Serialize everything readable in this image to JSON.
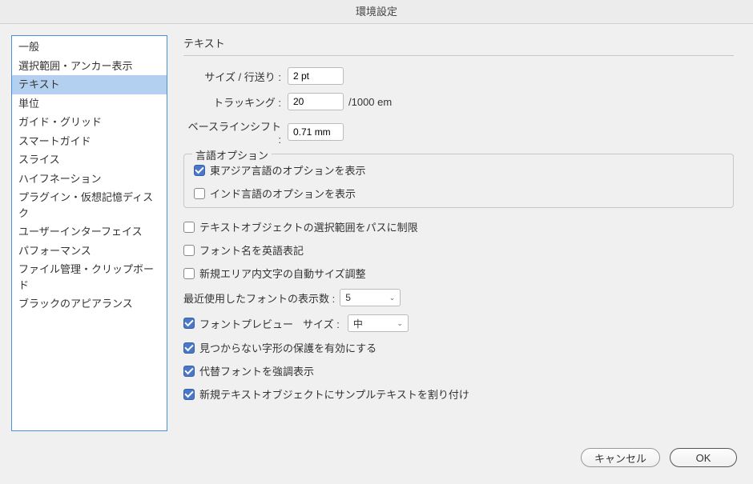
{
  "window": {
    "title": "環境設定"
  },
  "sidebar": {
    "items": [
      "一般",
      "選択範囲・アンカー表示",
      "テキスト",
      "単位",
      "ガイド・グリッド",
      "スマートガイド",
      "スライス",
      "ハイフネーション",
      "プラグイン・仮想記憶ディスク",
      "ユーザーインターフェイス",
      "パフォーマンス",
      "ファイル管理・クリップボード",
      "ブラックのアピアランス"
    ],
    "selected_index": 2
  },
  "panel": {
    "title": "テキスト",
    "fields": {
      "size_leading": {
        "label": "サイズ / 行送り :",
        "value": "2 pt"
      },
      "tracking": {
        "label": "トラッキング :",
        "value": "20",
        "suffix": "/1000 em"
      },
      "baseline": {
        "label": "ベースラインシフト :",
        "value": "0.71 mm"
      }
    },
    "language_group": {
      "legend": "言語オプション",
      "east_asian": {
        "label": "東アジア言語のオプションを表示",
        "checked": true
      },
      "indic": {
        "label": "インド言語のオプションを表示",
        "checked": false
      }
    },
    "limit_selection": {
      "label": "テキストオブジェクトの選択範囲をパスに制限",
      "checked": false
    },
    "english_font_names": {
      "label": "フォント名を英語表記",
      "checked": false
    },
    "auto_area_size": {
      "label": "新規エリア内文字の自動サイズ調整",
      "checked": false
    },
    "recent_fonts": {
      "label": "最近使用したフォントの表示数 :",
      "value": "5"
    },
    "font_preview": {
      "label": "フォントプレビュー",
      "checked": true,
      "size_label": "サイズ :",
      "size_value": "中"
    },
    "missing_glyph": {
      "label": "見つからない字形の保護を有効にする",
      "checked": true
    },
    "highlight_sub": {
      "label": "代替フォントを強調表示",
      "checked": true
    },
    "placeholder_text": {
      "label": "新規テキストオブジェクトにサンプルテキストを割り付け",
      "checked": true
    }
  },
  "footer": {
    "cancel": "キャンセル",
    "ok": "OK"
  }
}
